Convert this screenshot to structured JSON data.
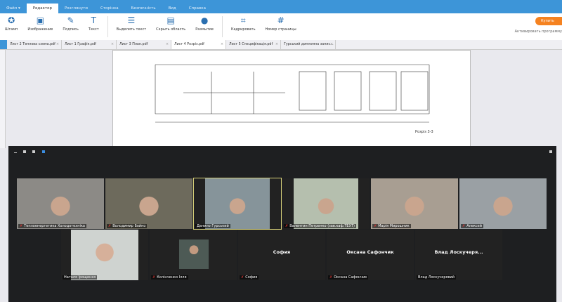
{
  "menu": [
    "Файл ▾",
    "Редактор",
    "Розглянути",
    "Сторінка",
    "Безпечність",
    "Вид",
    "Справка"
  ],
  "toolbar": [
    {
      "label": "Штамп",
      "icon": "stamp-icon",
      "g": "✪"
    },
    {
      "label": "Изображение",
      "icon": "image-icon",
      "g": "▣"
    },
    {
      "label": "Подпись",
      "icon": "signature-icon",
      "g": "✎"
    },
    {
      "label": "Текст",
      "icon": "text-icon",
      "g": "T"
    },
    {
      "label": "Выделить текст",
      "icon": "highlight-icon",
      "g": "☰"
    },
    {
      "label": "Скрыть область",
      "icon": "redact-icon",
      "g": "▤"
    },
    {
      "label": "Размытие",
      "icon": "blur-icon",
      "g": "●"
    },
    {
      "label": "Кадрировать",
      "icon": "crop-icon",
      "g": "⌗"
    },
    {
      "label": "Номер страницы",
      "icon": "page-number-icon",
      "g": "#"
    }
  ],
  "buy": "Купить",
  "activate": "Активировать программу",
  "tabs": [
    "Лист 2 Теплова схема.pdf",
    "Лист 1 Графік.pdf",
    "Лист 3 План.pdf",
    "Лист 4 Розріз.pdf",
    "Лист 5 Специфікація.pdf",
    "Гурський дипломна запис..."
  ],
  "drawing_label": "Розріз 3-3",
  "participants_row1": [
    {
      "name": "Теплоенергетика Холодотехніка",
      "muted": true
    },
    {
      "name": "Володимир Бойко",
      "muted": true
    },
    {
      "name": "Данило Гурський",
      "muted": false,
      "selected": true
    },
    {
      "name": "Валентин Петренко (зав.каф.ТЕХТ)",
      "muted": true
    },
    {
      "name": "Марія Мирошник",
      "muted": true
    },
    {
      "name": "Алексей",
      "muted": true
    }
  ],
  "participants_row2": [
    {
      "name": "Наталя Ірощенко",
      "muted": false,
      "video": true
    },
    {
      "name": "Колінченко Ілля",
      "muted": true,
      "video": true
    },
    {
      "name": "София",
      "muted": true,
      "display": "София"
    },
    {
      "name": "Оксана Сафончик",
      "muted": true,
      "display": "Оксана Сафончик"
    },
    {
      "name": "Влад Лоскучерявий",
      "muted": false,
      "display": "Влад  Лоскучеря..."
    }
  ]
}
